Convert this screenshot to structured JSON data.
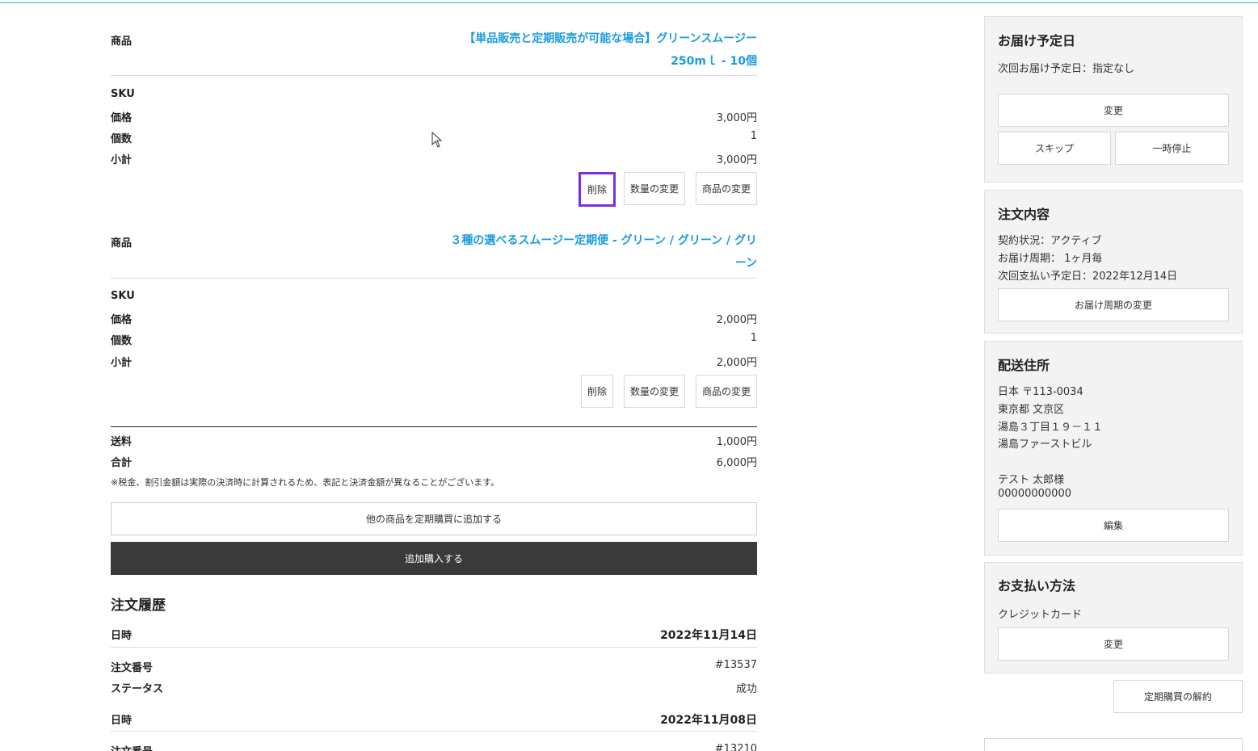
{
  "products": [
    {
      "label_product": "商品",
      "title_line1": "【単品販売と定期販売が可能な場合】グリーンスムージー",
      "title_line2": "250mｌ - 10個",
      "label_sku": "SKU",
      "label_price": "価格",
      "price": "3,000円",
      "label_qty": "個数",
      "qty": "1",
      "label_subtotal": "小計",
      "subtotal": "3,000円",
      "btn_delete": "削除",
      "btn_change_qty": "数量の変更",
      "btn_change_product": "商品の変更"
    },
    {
      "label_product": "商品",
      "title_line1": "３種の選べるスムージー定期便 - グリーン / グリーン / グリ",
      "title_line2": "ーン",
      "label_sku": "SKU",
      "label_price": "価格",
      "price": "2,000円",
      "label_qty": "個数",
      "qty": "1",
      "label_subtotal": "小計",
      "subtotal": "2,000円",
      "btn_delete": "削除",
      "btn_change_qty": "数量の変更",
      "btn_change_product": "商品の変更"
    }
  ],
  "summary": {
    "label_shipping": "送料",
    "shipping": "1,000円",
    "label_total": "合計",
    "total": "6,000円",
    "note": "※税金、割引金額は実際の決済時に計算されるため、表記と決済金額が異なることがございます。",
    "btn_add_other": "他の商品を定期購買に追加する",
    "btn_add_purchase": "追加購入する"
  },
  "history": {
    "title": "注文履歴",
    "entries": [
      {
        "label_date": "日時",
        "date": "2022年11月14日",
        "label_order_no": "注文番号",
        "order_no": "#13537",
        "label_status": "ステータス",
        "status": "成功"
      },
      {
        "label_date": "日時",
        "date": "2022年11月08日",
        "label_order_no": "注文番号",
        "order_no": "#13210"
      }
    ]
  },
  "sidebar": {
    "delivery": {
      "title": "お届け予定日",
      "next": "次回お届け予定日：指定なし",
      "btn_change": "変更",
      "btn_skip": "スキップ",
      "btn_pause": "一時停止"
    },
    "order": {
      "title": "注文内容",
      "status": "契約状況：アクティブ",
      "cycle": "お届け周期： 1ヶ月毎",
      "next_payment": "次回支払い予定日：2022年12月14日",
      "btn_change_cycle": "お届け周期の変更"
    },
    "address": {
      "title": "配送住所",
      "line1": "日本 〒113-0034",
      "line2": "東京都 文京区",
      "line3": "湯島３丁目１９－１１",
      "line4": "湯島ファーストビル",
      "name": "テスト 太郎様",
      "phone": "00000000000",
      "btn_edit": "編集"
    },
    "payment": {
      "title": "お支払い方法",
      "method": "クレジットカード",
      "btn_change": "変更"
    },
    "btn_cancel": "定期購買の解約"
  }
}
